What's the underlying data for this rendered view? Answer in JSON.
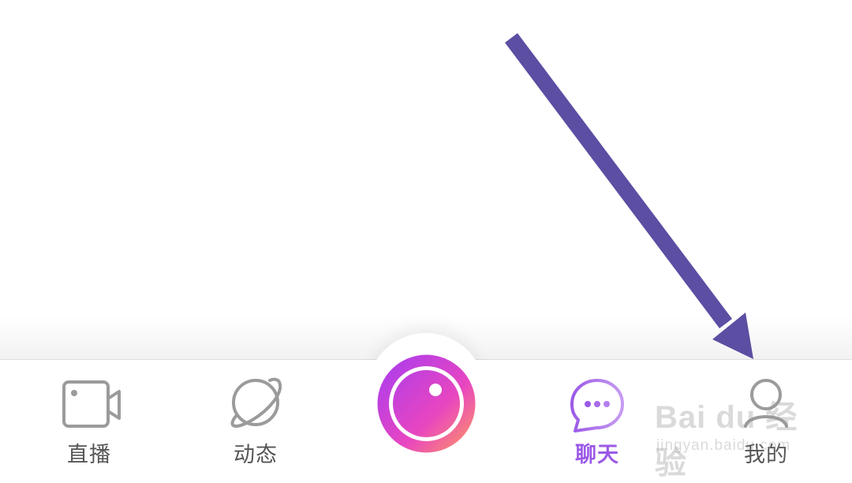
{
  "tabbar": {
    "tabs": [
      {
        "label": "直播",
        "icon": "video-camera-icon",
        "active": false
      },
      {
        "label": "动态",
        "icon": "planet-icon",
        "active": false
      },
      {
        "label": "聊天",
        "icon": "chat-bubble-icon",
        "active": true
      },
      {
        "label": "我的",
        "icon": "user-icon",
        "active": false
      }
    ],
    "center_button": {
      "icon": "camera-lens-icon"
    }
  },
  "colors": {
    "inactive": "#9b9b9b",
    "inactive_text": "#555555",
    "active": "#9b59e6",
    "record_gradient_start": "#b43cf0",
    "record_gradient_mid": "#e846c0",
    "record_gradient_end": "#ff9a5c",
    "annotation_arrow": "#5b4ea3"
  },
  "watermark": {
    "brand": "Bai du 经验",
    "url": "jingyan.baidu.com"
  }
}
